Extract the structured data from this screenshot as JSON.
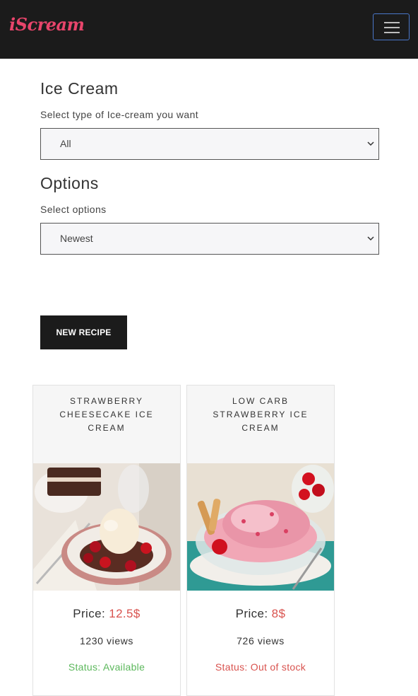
{
  "navbar": {
    "brand": "iScream",
    "toggle_icon": "hamburger-menu-icon"
  },
  "filters": {
    "icecream_title": "Ice Cream",
    "icecream_label": "Select type of Ice-cream you want",
    "icecream_selected": "All",
    "options_title": "Options",
    "options_label": "Select options",
    "options_selected": "Newest"
  },
  "actions": {
    "new_recipe_label": "NEW RECIPE"
  },
  "cards": [
    {
      "title": "STRAWBERRY CHEESECAKE ICE CREAM",
      "price_label": "Price:",
      "price_value": "12.5$",
      "views": "1230 views",
      "status": "Status: Available",
      "status_color": "#5cb85c"
    },
    {
      "title": "LOW CARB STRAWBERRY ICE CREAM",
      "price_label": "Price:",
      "price_value": "8$",
      "views": "726 views",
      "status": "Status: Out of stock",
      "status_color": "#d9534f"
    }
  ],
  "colors": {
    "navbar_bg": "#1b1b1b",
    "brand": "#e8456b",
    "price": "#d9534f"
  }
}
